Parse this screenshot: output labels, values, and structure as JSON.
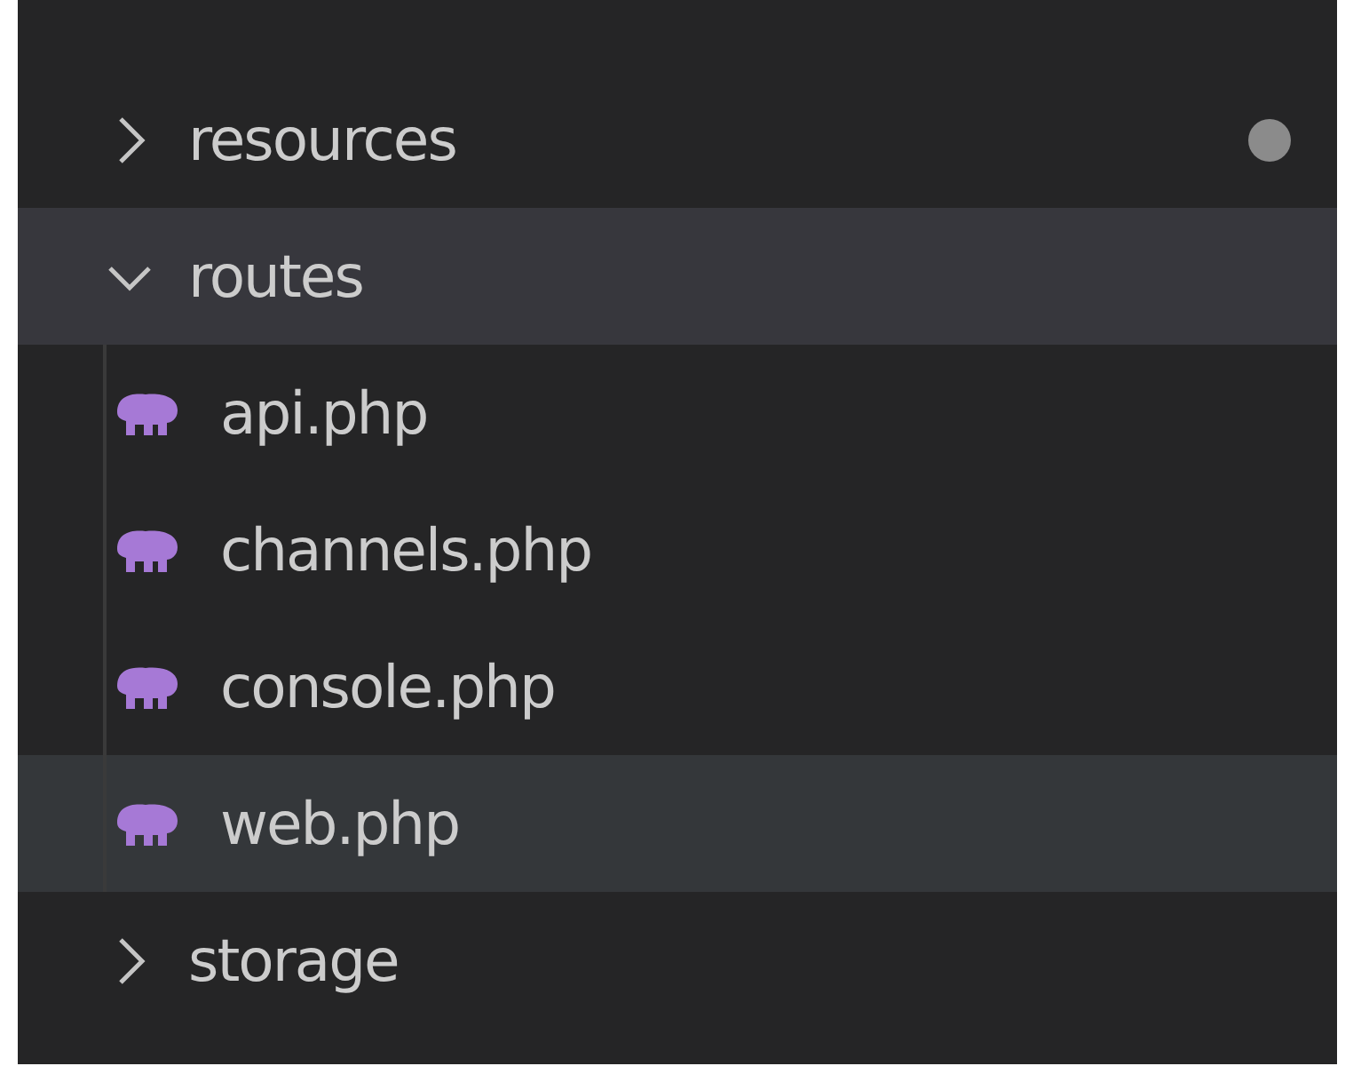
{
  "explorer": {
    "items": [
      {
        "name": "resources",
        "kind": "folder",
        "expanded": false,
        "modified": true,
        "selected": false,
        "hovered": false
      },
      {
        "name": "routes",
        "kind": "folder",
        "expanded": true,
        "modified": false,
        "selected": true,
        "hovered": false,
        "children": [
          {
            "name": "api.php",
            "kind": "php",
            "selected": false,
            "hovered": false
          },
          {
            "name": "channels.php",
            "kind": "php",
            "selected": false,
            "hovered": false
          },
          {
            "name": "console.php",
            "kind": "php",
            "selected": false,
            "hovered": false
          },
          {
            "name": "web.php",
            "kind": "php",
            "selected": false,
            "hovered": true
          }
        ]
      },
      {
        "name": "storage",
        "kind": "folder",
        "expanded": false,
        "modified": false,
        "selected": false,
        "hovered": false
      }
    ]
  }
}
